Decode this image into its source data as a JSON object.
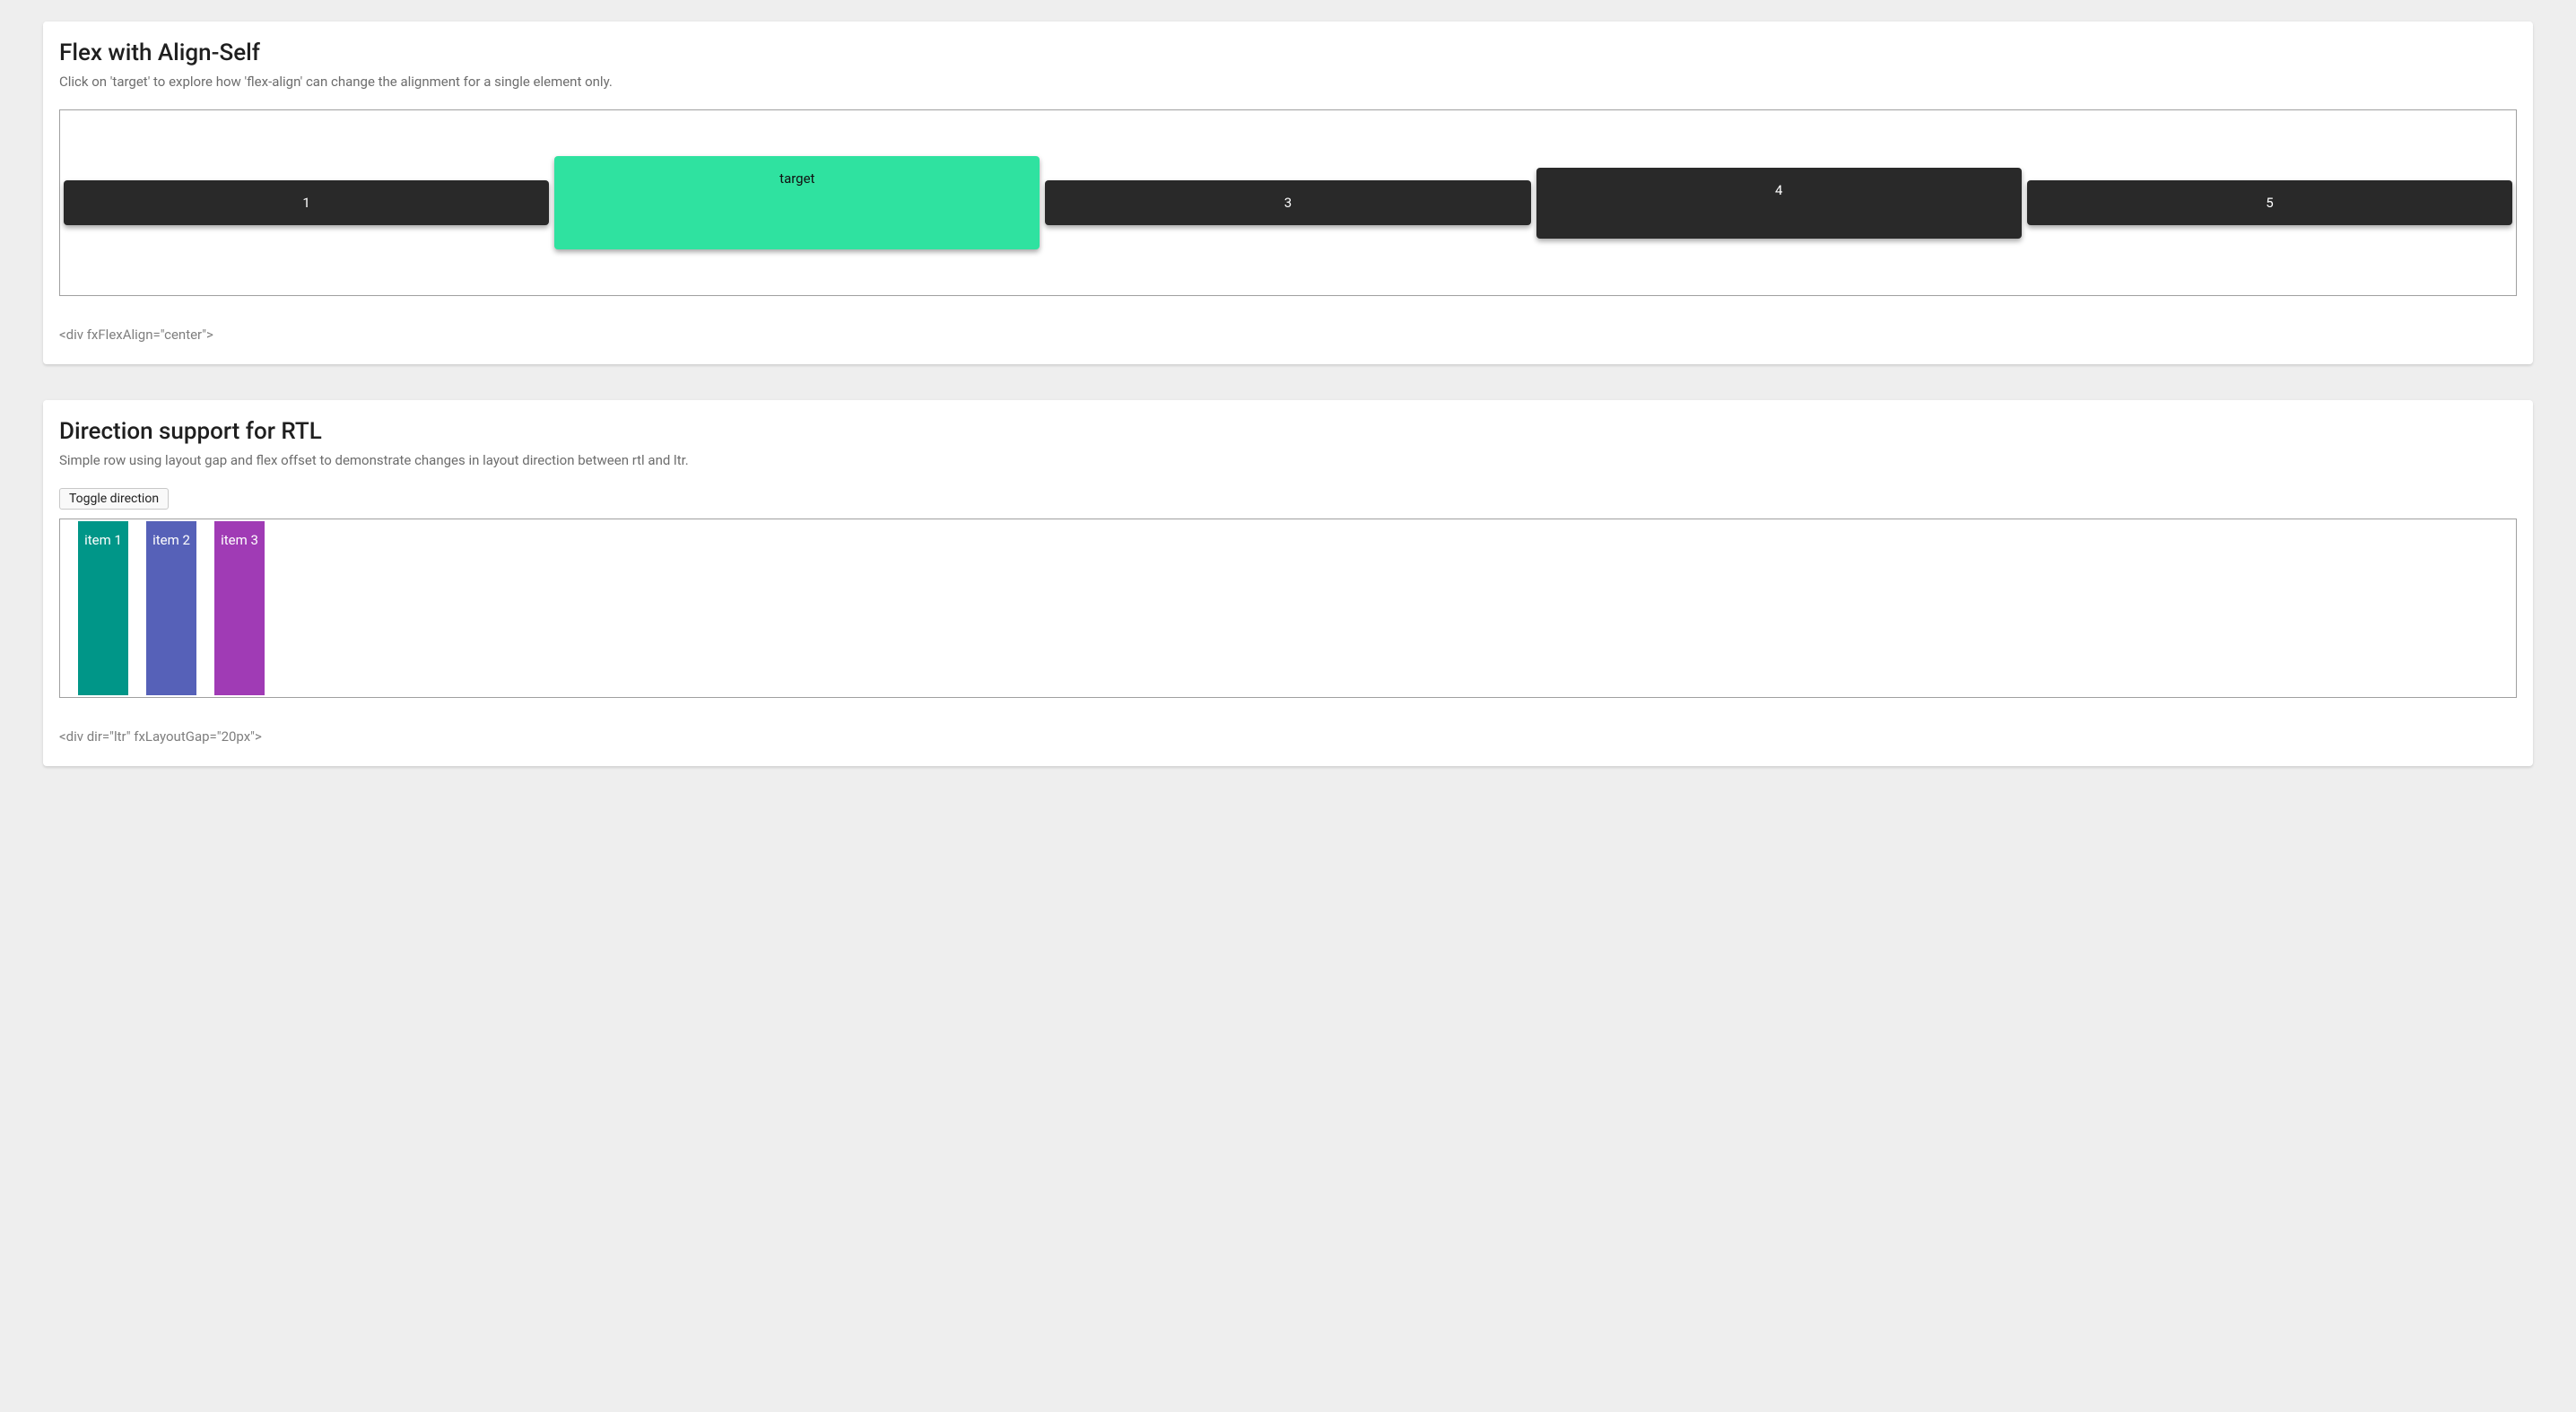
{
  "card1": {
    "title": "Flex with Align-Self",
    "subtitle": "Click on 'target' to explore how 'flex-align' can change the alignment for a single element only.",
    "items": [
      "1",
      "target",
      "3",
      "4",
      "5"
    ],
    "hint": "<div fxFlexAlign=\"center\">"
  },
  "card2": {
    "title": "Direction support for RTL",
    "subtitle": "Simple row using layout gap and flex offset to demonstrate changes in layout direction between rtl and ltr.",
    "toggle_label": "Toggle direction",
    "items": [
      "item 1",
      "item 2",
      "item 3"
    ],
    "hint": "<div dir=\"ltr\" fxLayoutGap=\"20px\">"
  }
}
